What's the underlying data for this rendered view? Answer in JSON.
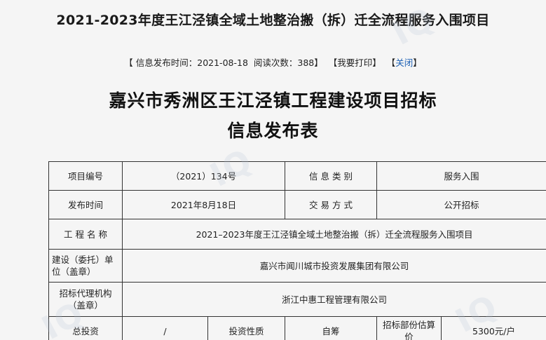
{
  "header": {
    "title": "2021-2023年度王江泾镇全域土地整治搬（拆）迁全流程服务入围项目"
  },
  "meta": {
    "publish_label": "【 信息发布时间：",
    "publish_date": "2021-08-18",
    "read_label": "阅读次数：",
    "read_count": "388",
    "bracket_close": "】",
    "print_label": "【我要打印】",
    "close_open": "【",
    "close_label": "关闭",
    "close_end": "】"
  },
  "document": {
    "title_line1": "嘉兴市秀洲区王江泾镇工程建设项目招标",
    "title_line2": "信息发布表"
  },
  "table": {
    "project_no_label": "项目编号",
    "project_no_value": "（2021）134号",
    "info_type_label": "信 息 类 别",
    "info_type_value": "服务入围",
    "publish_time_label": "发布时间",
    "publish_time_value": "2021年8月18日",
    "trade_mode_label": "交 易 方 式",
    "trade_mode_value": "公开招标",
    "project_name_label": "工 程 名 称",
    "project_name_value": "2021–2023年度王江泾镇全域土地整治搬（拆）迁全流程服务入围项目",
    "builder_label": "建设（委托）单位（盖章）",
    "builder_value": "嘉兴市闻川城市投资发展集团有限公司",
    "agency_label": "招标代理机构（盖章）",
    "agency_value": "浙江中惠工程管理有限公司",
    "total_invest_label": "总投资",
    "total_invest_value": "/",
    "invest_nature_label": "投资性质",
    "invest_nature_value": "自筹",
    "tender_price_label": "招标部份估算价",
    "tender_price_value": "5300元/户"
  }
}
